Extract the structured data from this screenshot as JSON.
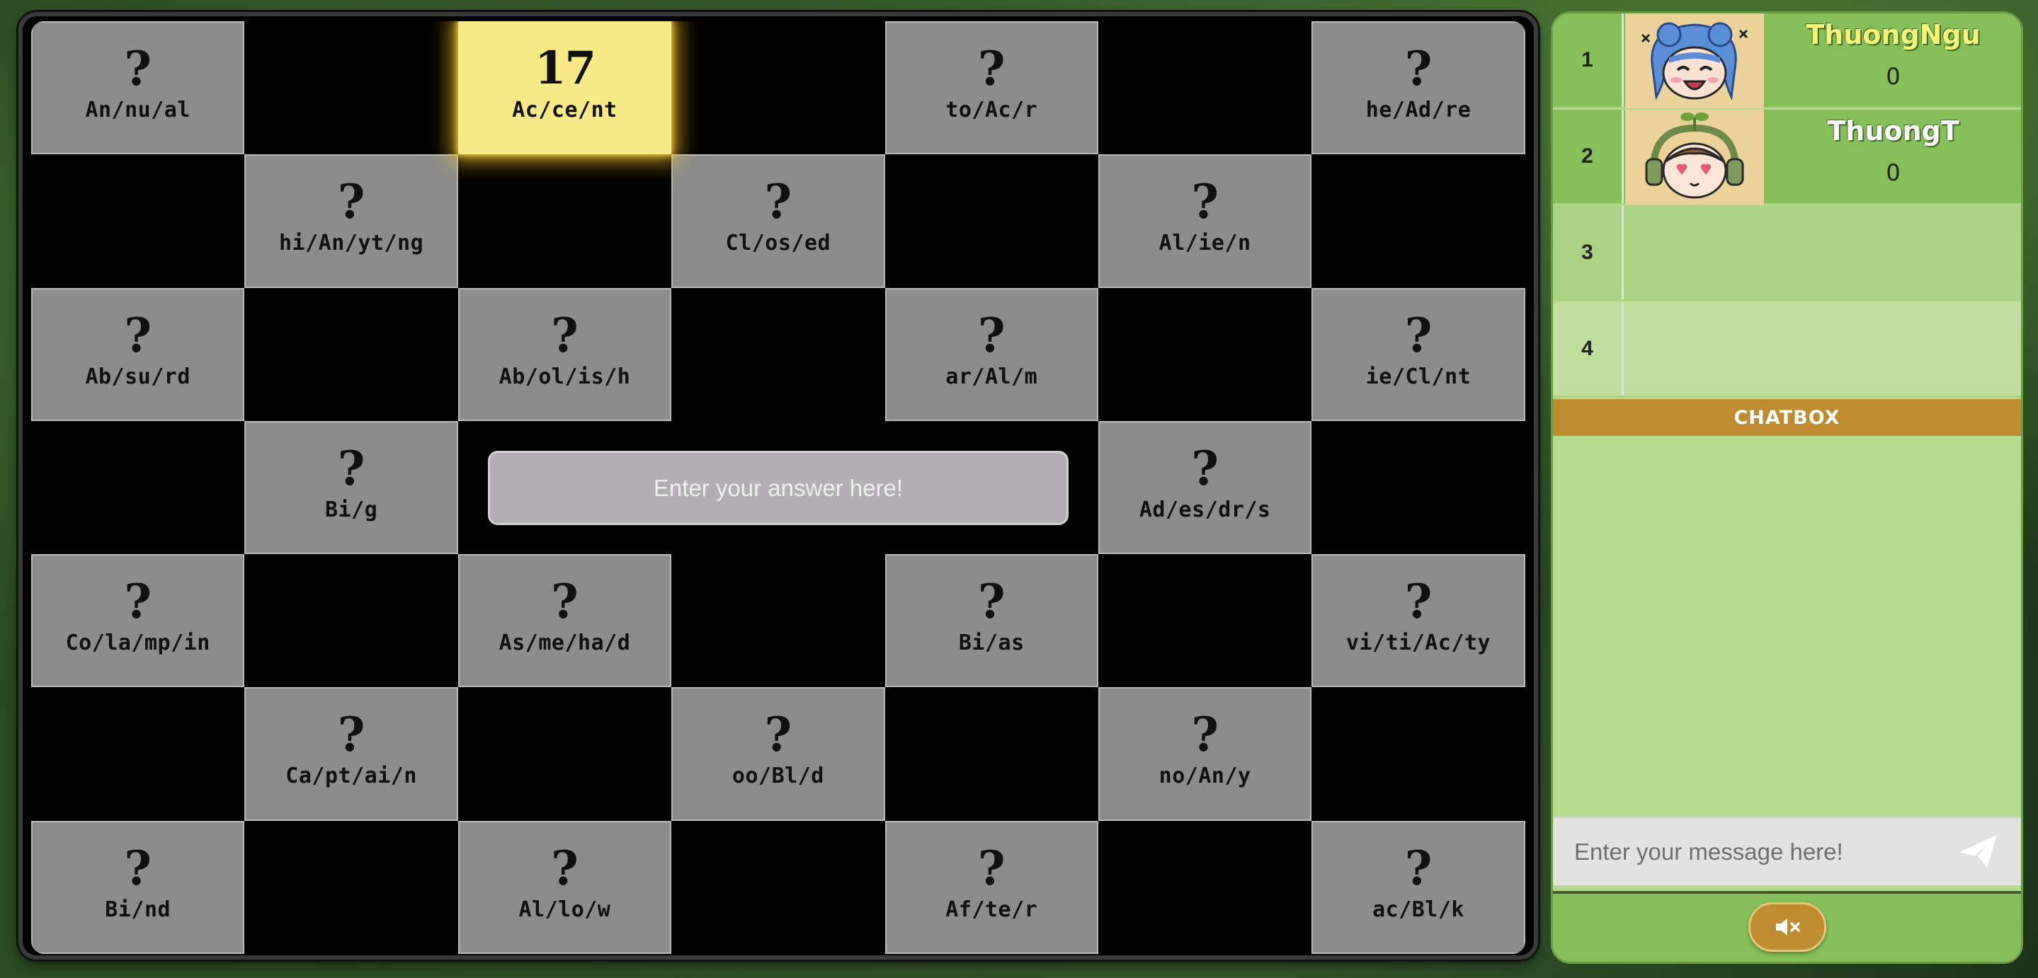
{
  "board": {
    "rows": [
      [
        {
          "word": "An/nu/al",
          "mark": "?"
        },
        null,
        {
          "word": "Ac/ce/nt",
          "mark": "17",
          "active": true
        },
        null,
        {
          "word": "to/Ac/r",
          "mark": "?"
        },
        null,
        {
          "word": "he/Ad/re",
          "mark": "?"
        }
      ],
      [
        null,
        {
          "word": "hi/An/yt/ng",
          "mark": "?"
        },
        null,
        {
          "word": "Cl/os/ed",
          "mark": "?"
        },
        null,
        {
          "word": "Al/ie/n",
          "mark": "?"
        },
        null
      ],
      [
        {
          "word": "Ab/su/rd",
          "mark": "?"
        },
        null,
        {
          "word": "Ab/ol/is/h",
          "mark": "?"
        },
        null,
        {
          "word": "ar/Al/m",
          "mark": "?"
        },
        null,
        {
          "word": "ie/Cl/nt",
          "mark": "?"
        }
      ],
      [
        null,
        {
          "word": "Bi/g",
          "mark": "?"
        },
        null,
        null,
        null,
        {
          "word": "Ad/es/dr/s",
          "mark": "?"
        },
        null
      ],
      [
        {
          "word": "Co/la/mp/in",
          "mark": "?"
        },
        null,
        {
          "word": "As/me/ha/d",
          "mark": "?"
        },
        null,
        {
          "word": "Bi/as",
          "mark": "?"
        },
        null,
        {
          "word": "vi/ti/Ac/ty",
          "mark": "?"
        }
      ],
      [
        null,
        {
          "word": "Ca/pt/ai/n",
          "mark": "?"
        },
        null,
        {
          "word": "oo/Bl/d",
          "mark": "?"
        },
        null,
        {
          "word": "no/An/y",
          "mark": "?"
        },
        null
      ],
      [
        {
          "word": "Bi/nd",
          "mark": "?"
        },
        null,
        {
          "word": "Al/lo/w",
          "mark": "?"
        },
        null,
        {
          "word": "Af/te/r",
          "mark": "?"
        },
        null,
        {
          "word": "ac/Bl/k",
          "mark": "?"
        }
      ]
    ],
    "answer_placeholder": "Enter your answer here!"
  },
  "leaderboard": [
    {
      "rank": "1",
      "name": "ThuongNgu",
      "score": "0",
      "avatar": "blue-hair-girl-avatar",
      "is_me": true
    },
    {
      "rank": "2",
      "name": "ThuongT",
      "score": "0",
      "avatar": "sprout-headphone-avatar",
      "is_me": false
    },
    {
      "rank": "3",
      "name": "",
      "score": ""
    },
    {
      "rank": "4",
      "name": "",
      "score": ""
    }
  ],
  "chat": {
    "header": "CHATBOX",
    "placeholder": "Enter your message here!",
    "send_icon": "send-icon"
  },
  "controls": {
    "mute_icon": "speaker-muted-icon"
  },
  "colors": {
    "tile": "#8c8c8c",
    "tile_active": "#f8e987",
    "panel_green": "#85bf59",
    "chat_header": "#bf8d2f",
    "my_name": "#f6f37a"
  }
}
